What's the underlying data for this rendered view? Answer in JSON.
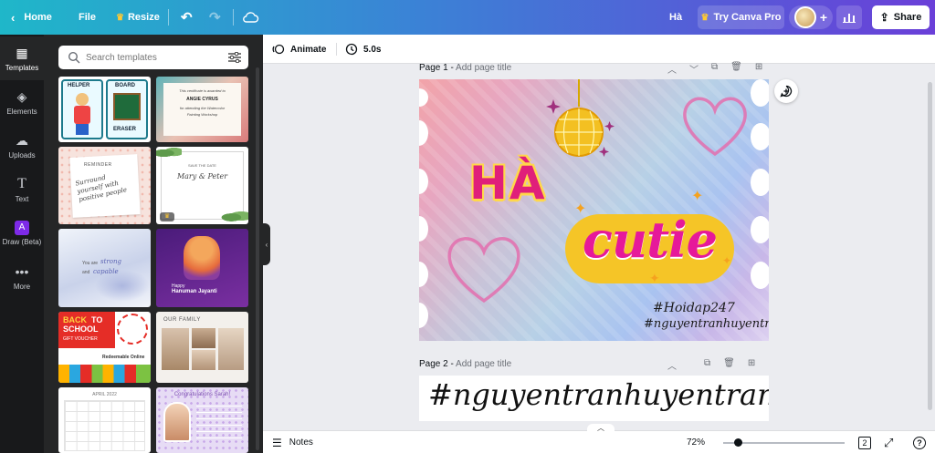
{
  "topbar": {
    "home_label": "Home",
    "file_label": "File",
    "resize_label": "Resize",
    "user_name": "Hà",
    "try_pro_label": "Try Canva Pro",
    "share_label": "Share",
    "add_label": "+"
  },
  "rail": {
    "items": [
      {
        "label": "Templates"
      },
      {
        "label": "Elements"
      },
      {
        "label": "Uploads"
      },
      {
        "label": "Text"
      },
      {
        "label": "Draw (Beta)"
      },
      {
        "label": "More"
      }
    ]
  },
  "panel": {
    "search_placeholder": "Search templates"
  },
  "templates": {
    "t1": {
      "w1": "HELPER",
      "w2": "BOARD",
      "w3": "ERASER"
    },
    "t2": {
      "line1": "This certificate is awarded to",
      "line2": "ANGIE CYRUS",
      "line3": "for attending the Watercolor",
      "line4": "Painting Workshop"
    },
    "t3": {
      "label": "REMINDER",
      "text": "Surround yourself with positive people"
    },
    "t4": {
      "label": "SAVE THE DATE",
      "names": "Mary & Peter"
    },
    "t5": {
      "line1": "You are",
      "line2": "strong",
      "line3": "and",
      "line4": "capable"
    },
    "t6": {
      "line1": "Happy",
      "line2": "Hanuman Jayanti"
    },
    "t7": {
      "line1": "BACK",
      "line2": "TO",
      "line3": "SCHOOL",
      "line4": "GIFT VOUCHER",
      "line5": "Redeemable Online"
    },
    "t8": {
      "title": "OUR FAMILY"
    },
    "t9": {
      "title": "APRIL 2022"
    },
    "t10": {
      "title": "Congratulations Sarah!"
    }
  },
  "canvas_toolbar": {
    "animate_label": "Animate",
    "duration_label": "5.0s"
  },
  "pages": {
    "page1_label": "Page 1 - ",
    "page1_sub": "Add page title",
    "page2_label": "Page 2 - ",
    "page2_sub": "Add page title"
  },
  "design": {
    "ha_text": "HÀ",
    "cutie_text": "cutie",
    "tag1": "#Hoidap247",
    "tag2": "#nguyentranhuyentram:)))",
    "page2_text": "#nguyentranhuyentram:)))"
  },
  "bottombar": {
    "notes_label": "Notes",
    "zoom_label": "72%",
    "zoom_value": 72,
    "page_count": "2",
    "help_label": "?"
  },
  "colors": {
    "rail_bg": "#18191b",
    "panel_bg": "#252627",
    "accent_purple": "#7d2ae8",
    "cutie_pink": "#e6199a",
    "cutie_yellow": "#f5c527"
  }
}
